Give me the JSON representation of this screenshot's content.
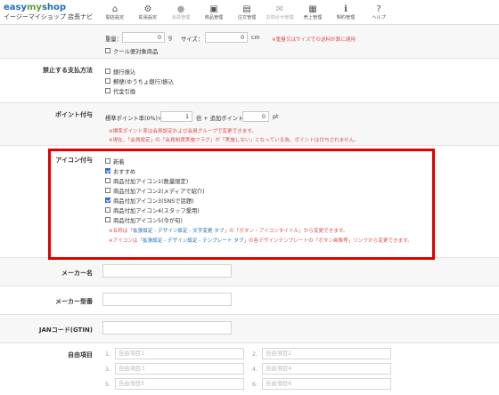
{
  "header": {
    "logo_main_a": "easy",
    "logo_main_b": "my",
    "logo_main_c": "shop",
    "logo_sub": "イージーマイショップ 店長ナビ",
    "nav": [
      {
        "label": "開店設定",
        "icon": "house-icon"
      },
      {
        "label": "拡張設定",
        "icon": "gear-icon"
      },
      {
        "label": "会員管理",
        "icon": "person-icon"
      },
      {
        "label": "商品管理",
        "icon": "gift-icon"
      },
      {
        "label": "注文管理",
        "icon": "document-icon"
      },
      {
        "label": "お問合せ管理",
        "icon": "envelope-icon"
      },
      {
        "label": "売上管理",
        "icon": "table-icon"
      },
      {
        "label": "契約管理",
        "icon": "info-icon"
      },
      {
        "label": "ヘルプ",
        "icon": "question-icon"
      }
    ]
  },
  "weight_row": {
    "weight_label": "重量：",
    "weight_value": "0",
    "weight_unit": "g",
    "size_label": "サイズ：",
    "size_value": "0",
    "size_unit": "cm",
    "note": "※重量又はサイズでの送料計算に適用",
    "cool_label": "クール便対象商品"
  },
  "payment": {
    "label": "禁止する支払方法",
    "options": [
      "銀行振込",
      "郵便(ゆうちょ銀行)振込",
      "代金引換"
    ]
  },
  "points": {
    "label": "ポイント付与",
    "standard_label": "標準ポイント率(0%)×",
    "multiplier": "1",
    "mid_text": "倍 + 追加ポイント",
    "additional": "0",
    "unit": "pt",
    "note1": "※標準ポイント率は会員設定および会員グループで変更できます。",
    "note2": "※現在、「会員設定」の「会員制度実施フラグ」が「実施しない」となっている為、ポイントは付与されません。"
  },
  "icons": {
    "label": "アイコン付与",
    "options": [
      {
        "label": "新着",
        "checked": false
      },
      {
        "label": "おすすめ",
        "checked": true
      },
      {
        "label": "商品付加アイコン1(数量限定)",
        "checked": false
      },
      {
        "label": "商品付加アイコン2(メディアで紹介)",
        "checked": false
      },
      {
        "label": "商品付加アイコン3(SNSで話題)",
        "checked": true
      },
      {
        "label": "商品付加アイコン4(スタッフ愛用)",
        "checked": false
      },
      {
        "label": "商品付加アイコン5(今が旬)",
        "checked": false
      }
    ],
    "note1_a": "※名称は「",
    "note1_link": "拡張設定 - デザイン設定 - 文字変更 タブ",
    "note1_b": "」の「ボタン・アイコンタイトル」から変更できます。",
    "note2_a": "※アイコンは「",
    "note2_link": "拡張設定 - デザイン設定 - テンプレート タブ",
    "note2_b": "」の各デザインテンプレートの「ボタン画像等」リンクから変更できます。"
  },
  "maker": {
    "label": "メーカー名"
  },
  "maker_model": {
    "label": "メーカー型番"
  },
  "jan": {
    "label": "JANコード(GTIN)"
  },
  "free": {
    "label": "自由項目",
    "items": [
      {
        "num": "1.",
        "placeholder": "自由項目1"
      },
      {
        "num": "2.",
        "placeholder": "自由項目2"
      },
      {
        "num": "3.",
        "placeholder": "自由項目3"
      },
      {
        "num": "4.",
        "placeholder": "自由項目4"
      },
      {
        "num": "5.",
        "placeholder": "自由項目5"
      },
      {
        "num": "6.",
        "placeholder": "自由項目6"
      }
    ]
  },
  "colors": {
    "accent": "#1f6fb8",
    "highlight": "#e00000",
    "note": "#d9534f",
    "checked": "#2d6fd6"
  }
}
